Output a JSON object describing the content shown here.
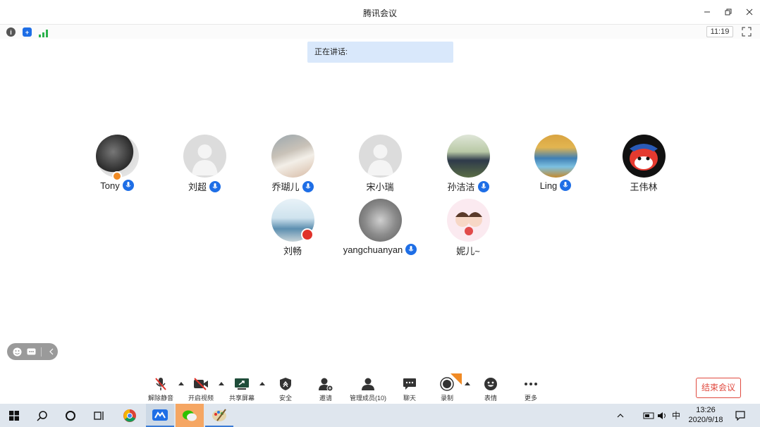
{
  "window": {
    "title": "腾讯会议"
  },
  "infobar": {
    "timer": "11:19"
  },
  "speaking": {
    "label": "正在讲话:"
  },
  "participants": [
    {
      "name": "Tony",
      "mic": true,
      "host": true
    },
    {
      "name": "刘超",
      "mic": true
    },
    {
      "name": "乔瑚儿",
      "mic": true
    },
    {
      "name": "宋小瑞",
      "mic": false
    },
    {
      "name": "孙洁洁",
      "mic": true
    },
    {
      "name": "Ling",
      "mic": true
    },
    {
      "name": "王伟林",
      "mic": false
    },
    {
      "name": "刘畅",
      "mic": false
    },
    {
      "name": "yangchuanyan",
      "mic": true
    },
    {
      "name": "妮儿~",
      "mic": false
    }
  ],
  "toolbar": {
    "unmute": "解除静音",
    "start_video": "开启视频",
    "share_screen": "共享屏幕",
    "security": "安全",
    "invite": "邀请",
    "manage_members": "管理成员(10)",
    "chat": "聊天",
    "record": "录制",
    "reactions": "表情",
    "more": "更多",
    "end_meeting": "结束会议"
  },
  "taskbar": {
    "ime": "中",
    "time": "13:26",
    "date": "2020/9/18"
  },
  "colors": {
    "accent_blue": "#1e6ee6",
    "speaking_bg": "#d9e8fb",
    "end_red": "#e04a3f",
    "taskbar_bg": "#dfe6ee"
  }
}
